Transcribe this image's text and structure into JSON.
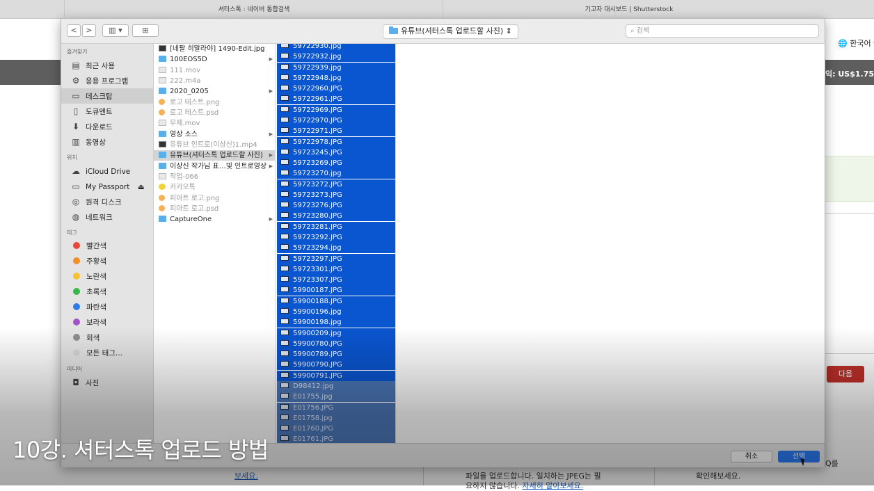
{
  "browser": {
    "tabs": [
      "셔터스톡 : 네이버 통합검색",
      "기고자 대시보드 | Shutterstock"
    ],
    "language": "한국어",
    "earnings": "익: US$1.75",
    "next_button": "다음",
    "footer_left_link": "보세요.",
    "footer_mid_line1": "파일을 업로드합니다. 일치하는 JPEG는 필",
    "footer_mid_line2_prefix": "요하지 않습니다. ",
    "footer_mid_line2_link": "자세히 알아보세요.",
    "footer_right": "확인해보세요.",
    "footer_far_right": "Q를"
  },
  "dialog": {
    "location": "유튜브(셔터스톡 업로드할 사진)",
    "search_placeholder": "검색",
    "sidebar": {
      "favorites_header": "즐겨찾기",
      "favorites": [
        {
          "label": "최근 사용",
          "icon": "recents-icon"
        },
        {
          "label": "응용 프로그램",
          "icon": "applications-icon"
        },
        {
          "label": "데스크탑",
          "icon": "desktop-icon"
        },
        {
          "label": "도큐멘트",
          "icon": "documents-icon"
        },
        {
          "label": "다운로드",
          "icon": "downloads-icon"
        },
        {
          "label": "동영상",
          "icon": "movies-icon"
        }
      ],
      "locations_header": "위치",
      "locations": [
        {
          "label": "iCloud Drive",
          "icon": "cloud-icon"
        },
        {
          "label": "My Passport",
          "icon": "drive-icon"
        },
        {
          "label": "원격 디스크",
          "icon": "disc-icon"
        },
        {
          "label": "네트워크",
          "icon": "network-icon"
        }
      ],
      "tags_header": "태그",
      "tags": [
        {
          "label": "빨간색",
          "color": "#e8473c"
        },
        {
          "label": "주황색",
          "color": "#f0902a"
        },
        {
          "label": "노란색",
          "color": "#f4c430"
        },
        {
          "label": "초록색",
          "color": "#3bb54a"
        },
        {
          "label": "파란색",
          "color": "#2f7de1"
        },
        {
          "label": "보라색",
          "color": "#a154c8"
        },
        {
          "label": "회색",
          "color": "#8e8e8e"
        },
        {
          "label": "모든 태그...",
          "color": "#d6d6d6"
        }
      ],
      "media_header": "미디어",
      "media": [
        {
          "label": "사진",
          "icon": "camera-icon"
        }
      ]
    },
    "column1": [
      {
        "name": "[네팔 히말라야] 1490-Edit.jpg",
        "kind": "img"
      },
      {
        "name": "100EOS5D",
        "kind": "folder",
        "arrow": true
      },
      {
        "name": "111.mov",
        "kind": "file",
        "dim": true
      },
      {
        "name": "222.m4a",
        "kind": "file",
        "dim": true
      },
      {
        "name": "2020_0205",
        "kind": "folder",
        "arrow": true
      },
      {
        "name": "로고 테스트.png",
        "kind": "png",
        "dim": true
      },
      {
        "name": "로고 테스트.psd",
        "kind": "png",
        "dim": true
      },
      {
        "name": "무제.mov",
        "kind": "file",
        "dim": true
      },
      {
        "name": "영상 소스",
        "kind": "folder",
        "arrow": true
      },
      {
        "name": "유튜브 인트로(이상신)1.mp4",
        "kind": "img",
        "dim": true
      },
      {
        "name": "유튜브(셔터스톡 업로드할 사진)",
        "kind": "folder",
        "arrow": true,
        "selected": true
      },
      {
        "name": "이상신 작가님 표…및 인트로영상",
        "kind": "folder",
        "arrow": true
      },
      {
        "name": "작업-066",
        "kind": "file",
        "dim": true
      },
      {
        "name": "카카오톡",
        "kind": "kakao",
        "dim": true
      },
      {
        "name": "피아트 로고.png",
        "kind": "png",
        "dim": true
      },
      {
        "name": "피아트 로고.psd",
        "kind": "png",
        "dim": true
      },
      {
        "name": "CaptureOne",
        "kind": "folder",
        "arrow": true
      }
    ],
    "column2": [
      "59722930.jpg",
      "59722932.jpg",
      "59722939.jpg",
      "59722948.jpg",
      "59722960.JPG",
      "59722961.JPG",
      "59722969.JPG",
      "59722970.JPG",
      "59722971.JPG",
      "59722978.JPG",
      "59723245.JPG",
      "59723269.JPG",
      "59723270.jpg",
      "59723272.JPG",
      "59723273.JPG",
      "59723276.JPG",
      "59723280.JPG",
      "59723281.JPG",
      "59723292.JPG",
      "59723294.jpg",
      "59723297.JPG",
      "59723301.JPG",
      "59723307.JPG",
      "59900187.JPG",
      "59900188.JPG",
      "59900196.jpg",
      "59900198.jpg",
      "59900209.jpg",
      "59900780.JPG",
      "59900789.JPG",
      "59900790.JPG",
      "59900791.JPG",
      "D98412.jpg",
      "E01755.jpg",
      "E01756.JPG",
      "E01758.jpg",
      "E01760.JPG",
      "E01761.JPG"
    ],
    "column2_dim_from": 32,
    "cancel_label": "취소",
    "select_label": "선택"
  },
  "caption": "10강. 셔터스톡 업로드 방법"
}
